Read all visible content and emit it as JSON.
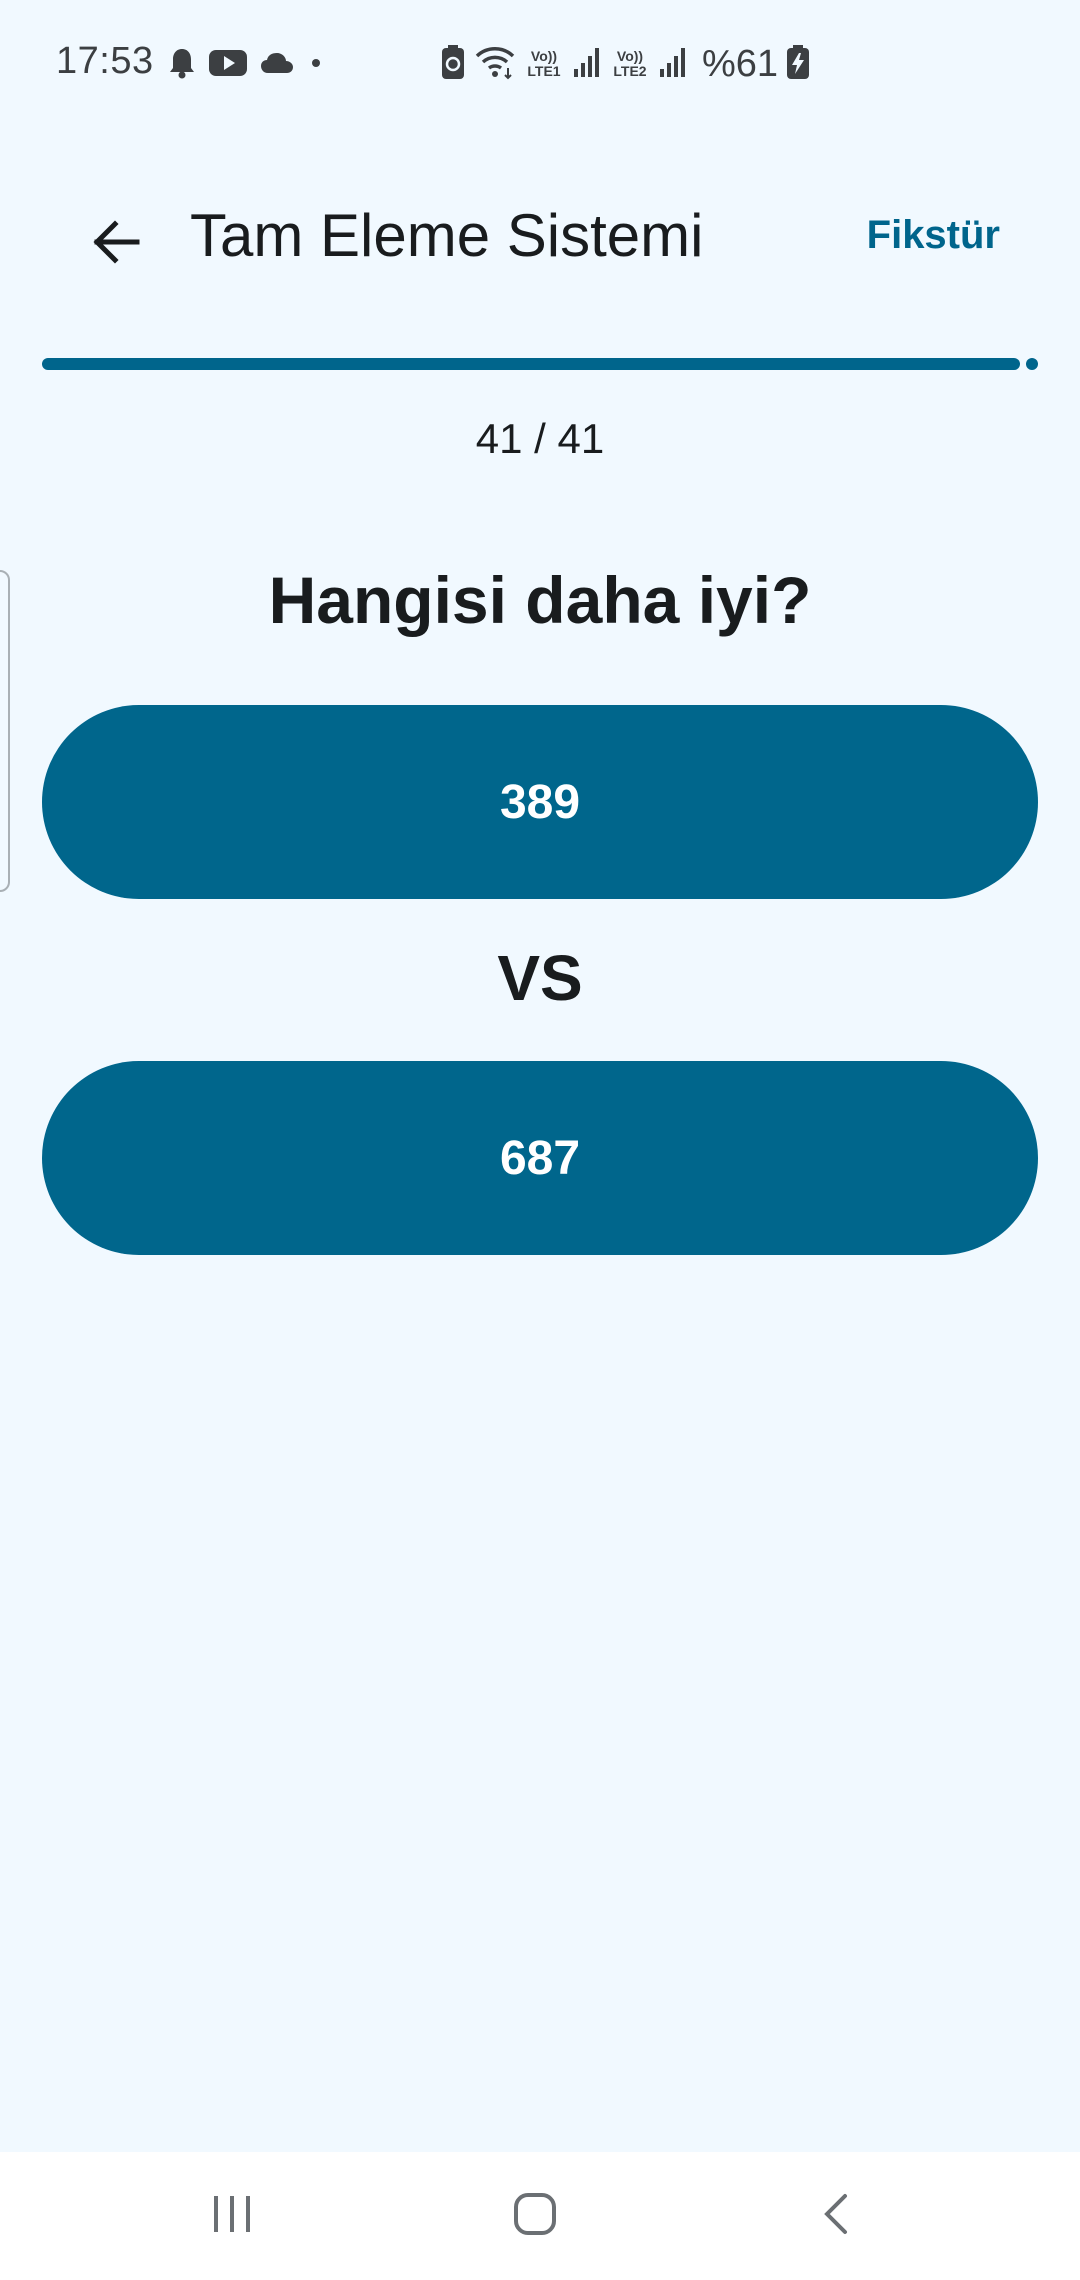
{
  "status_bar": {
    "time": "17:53",
    "left_icons": [
      "notification-bell-icon",
      "youtube-icon",
      "cloud-icon",
      "dot-icon"
    ],
    "right_icons": [
      "battery-saver-icon",
      "wifi-icon",
      "lte1-signal-icon",
      "lte2-signal-icon",
      "battery-charging-icon"
    ],
    "lte1_top": "Vo))",
    "lte1_bottom": "LTE1",
    "lte2_top": "Vo))",
    "lte2_bottom": "LTE2",
    "battery": "%61"
  },
  "app_bar": {
    "back_icon": "arrow-back-icon",
    "title": "Tam Eleme Sistemi",
    "action_label": "Fikstür"
  },
  "progress": {
    "label": "41 / 41",
    "current": 41,
    "total": 41,
    "color": "#00658c"
  },
  "match": {
    "question": "Hangisi daha iyi?",
    "option_a": "389",
    "vs": "VS",
    "option_b": "687",
    "button_color": "#00668c"
  },
  "nav_bar": {
    "recents_icon": "recents-icon",
    "home_icon": "home-icon",
    "back_icon": "nav-back-icon"
  },
  "colors": {
    "background": "#f1f9ff",
    "accent": "#00658c",
    "text": "#191c1e"
  }
}
